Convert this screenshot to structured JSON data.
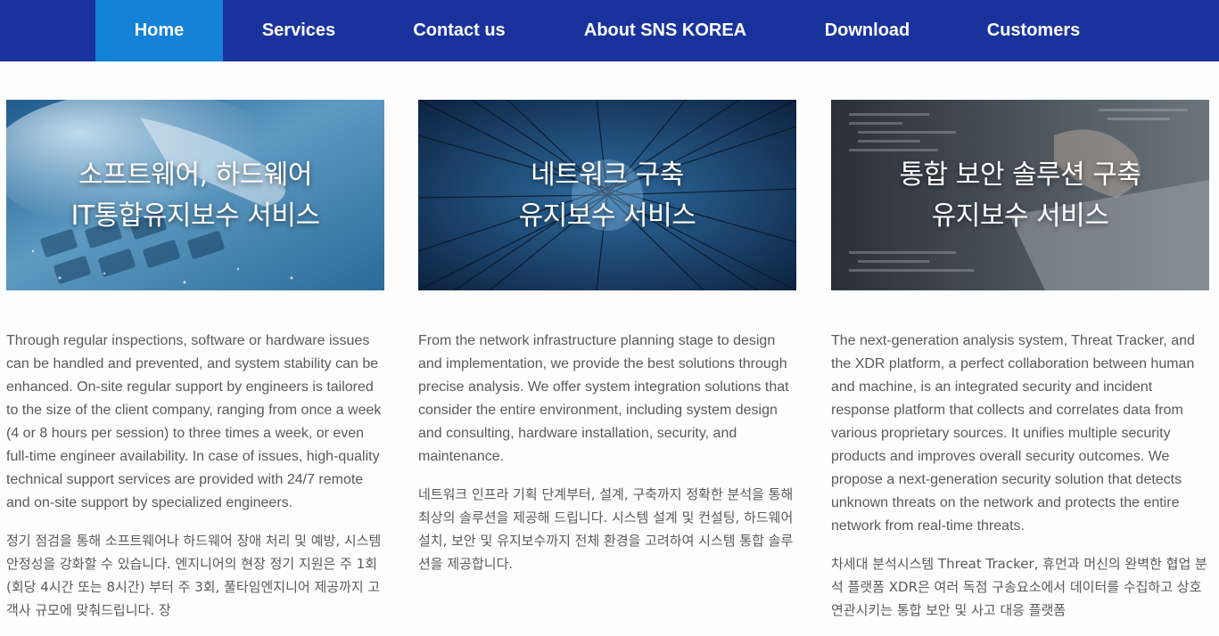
{
  "nav": {
    "items": [
      {
        "label": "Home",
        "active": true
      },
      {
        "label": "Services"
      },
      {
        "label": "Contact us"
      },
      {
        "label": "About SNS KOREA"
      },
      {
        "label": "Download"
      },
      {
        "label": "Customers"
      }
    ]
  },
  "cards": [
    {
      "title_line1": "소프트웨어, 하드웨어",
      "title_line2": "IT통합유지보수 서비스",
      "desc_en": "Through regular inspections, software or hardware issues can be handled and prevented, and system stability can be enhanced. On-site regular support by engineers is tailored to the size of the client company, ranging from once a week (4 or 8 hours per session) to three times a week, or even full-time engineer availability. In case of issues, high-quality technical support services are provided with 24/7 remote and on-site support by specialized engineers.",
      "desc_ko": "정기 점검을 통해 소프트웨어나 하드웨어 장애 처리 및 예방, 시스템 안정성을 강화할 수 있습니다. 엔지니어의 현장 정기 지원은 주 1회 (회당 4시간 또는 8시간) 부터 주 3회, 풀타임엔지니어 제공까지 고객사 규모에 맞춰드립니다. 장"
    },
    {
      "title_line1": "네트워크 구축",
      "title_line2": "유지보수 서비스",
      "desc_en": "From the network infrastructure planning stage to design and implementation, we provide the best solutions through precise analysis. We offer system integration solutions that consider the entire environment, including system design and consulting, hardware installation, security, and maintenance.",
      "desc_ko": "네트워크 인프라 기획 단계부터, 설계, 구축까지 정확한 분석을 통해 최상의 솔루션을 제공해 드립니다. 시스템 설계 및 컨설팅, 하드웨어 설치, 보안 및 유지보수까지 전체 환경을 고려하여 시스템 통합 솔루션을 제공합니다."
    },
    {
      "title_line1": "통합 보안 솔루션 구축",
      "title_line2": "유지보수 서비스",
      "desc_en": "The next-generation analysis system, Threat Tracker, and the XDR platform, a perfect collaboration between human and machine, is an integrated security and incident response platform that collects and correlates data from various proprietary sources. It unifies multiple security products and improves overall security outcomes. We propose a next-generation security solution that detects unknown threats on the network and protects the entire network from real-time threats.",
      "desc_ko": "차세대 분석시스템 Threat Tracker, 휴먼과 머신의 완벽한 협업 분석 플랫폼 XDR은 여러 독점 구송요소에서 데이터를 수집하고 상호 연관시키는 통합 보안 및 사고 대응 플랫폼"
    }
  ],
  "colors": {
    "nav_bg": "#1a339c",
    "nav_active": "#1482d6"
  }
}
